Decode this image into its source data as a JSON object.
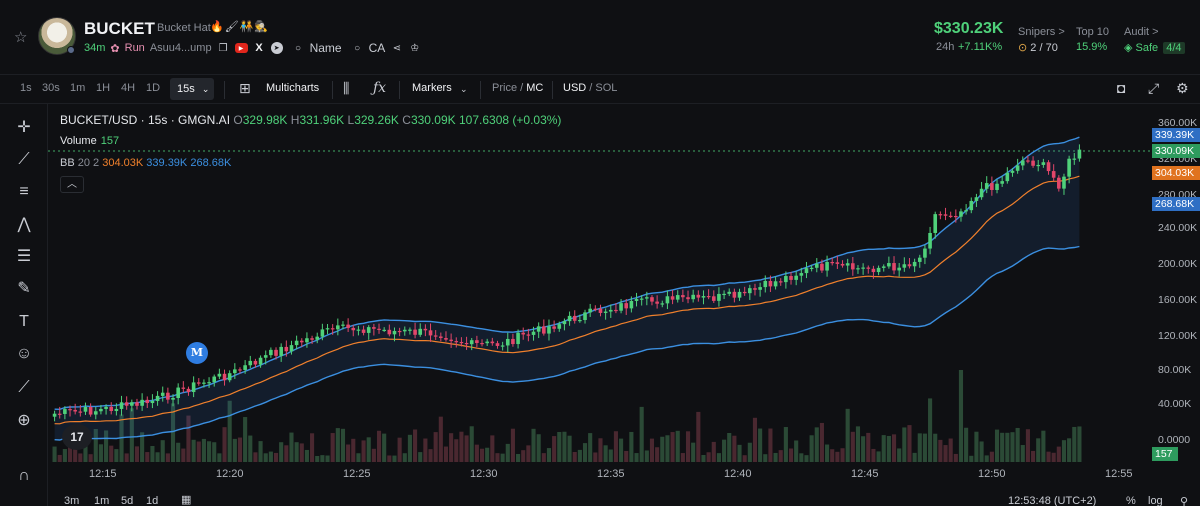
{
  "header": {
    "symbol": "BUCKET",
    "name": "Bucket Hat",
    "emoji": "🔥🖌🧑‍🤝‍🧑🕵",
    "age": "34m",
    "run_label": "Run",
    "address": "Asuu4...ump",
    "search_name": "Name",
    "search_ca": "CA",
    "price": "$330.23K",
    "change_label": "24h",
    "change_value": "+7.11K%",
    "snipers_label": "Snipers >",
    "snipers_value": "2",
    "snipers_total": "/ 70",
    "top10_label": "Top 10",
    "top10_value": "15.9%",
    "audit_label": "Audit >",
    "audit_value": "Safe",
    "audit_badge": "4/4"
  },
  "toolbar": {
    "timeframes": [
      "1s",
      "30s",
      "1m",
      "1H",
      "4H",
      "1D"
    ],
    "active_timeframe": "15s",
    "multicharts": "Multicharts",
    "markers": "Markers",
    "price_label": "Price",
    "mc_label": "MC",
    "usd_label": "USD",
    "sol_label": "SOL"
  },
  "legend": {
    "pair": "BUCKET/USD · 15s · GMGN.AI",
    "o_label": "O",
    "o_value": "329.98K",
    "h_label": "H",
    "h_value": "331.96K",
    "l_label": "L",
    "l_value": "329.26K",
    "c_label": "C",
    "c_value": "330.09K",
    "change": "107.6308 (+0.03%)",
    "volume_label": "Volume",
    "volume_value": "157",
    "bb_label": "BB",
    "bb_params": "20 2",
    "bb_mid": "304.03K",
    "bb_upper": "339.39K",
    "bb_lower": "268.68K"
  },
  "chart_data": {
    "type": "candlestick",
    "y_ticks": [
      "360.00K",
      "320.00K",
      "280.00K",
      "240.00K",
      "200.00K",
      "160.00K",
      "120.00K",
      "80.00K",
      "40.00K",
      "0.0000"
    ],
    "x_ticks": [
      "12:15",
      "12:20",
      "12:25",
      "12:30",
      "12:35",
      "12:40",
      "12:45",
      "12:50",
      "12:55"
    ],
    "price_tags": {
      "upper": "339.39K",
      "last": "330.09K",
      "mid": "304.03K",
      "lower": "268.68K",
      "volume": "157"
    },
    "colors": {
      "up": "#4fd17a",
      "down": "#e2466a",
      "mid": "#f0802c",
      "band": "#3b8fe0"
    }
  },
  "bottom": {
    "ranges": [
      "3m",
      "1m",
      "5d",
      "1d"
    ],
    "clock": "12:53:48 (UTC+2)",
    "pct": "%",
    "log": "log"
  },
  "marker_letter": "M",
  "tv_logo": "17"
}
